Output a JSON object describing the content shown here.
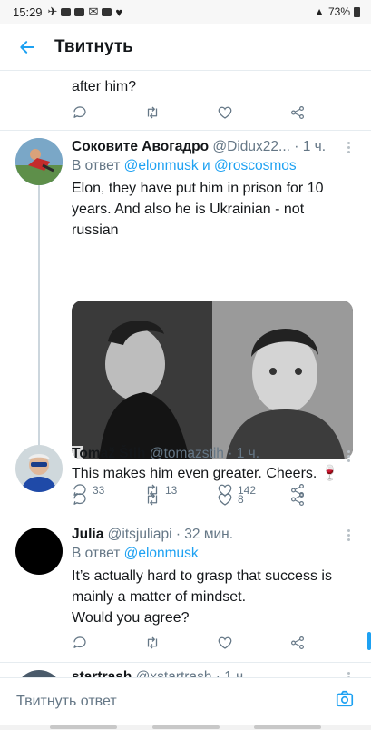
{
  "status_bar": {
    "time": "15:29",
    "battery": "73%"
  },
  "app_bar": {
    "title": "Твитнуть"
  },
  "tweet_prev": {
    "text_tail": "after him?"
  },
  "tweet1": {
    "name": "Соковите Авогадро",
    "handle": "@Didux22...",
    "time": "· 1 ч.",
    "reply_prefix": "В ответ",
    "reply_user1": "@elonmusk",
    "reply_and": "и",
    "reply_user2": "@roscosmos",
    "text": "Elon, they have put him in prison for 10 years. And also he is Ukrainian - not russian",
    "replies": "33",
    "retweets": "13",
    "likes": "142"
  },
  "tweet2": {
    "name": "Tomaž Štih",
    "handle": "@tomazstih",
    "time": "· 1 ч.",
    "text": "This makes him even greater. Cheers. 🍷",
    "likes": "8"
  },
  "tweet3": {
    "name": "Julia",
    "handle": "@itsjuliapi",
    "time": "· 32 мин.",
    "reply_prefix": "В ответ",
    "reply_user1": "@elonmusk",
    "text_line1": "It’s actually hard to grasp that success is",
    "text_line2": "mainly a matter of mindset.",
    "text_line3": "Would you agree?"
  },
  "tweet4": {
    "name": "startrash",
    "handle": "@xstartrash",
    "time": "· 1 ч."
  },
  "composer": {
    "placeholder": "Твитнуть ответ"
  },
  "colors": {
    "accent": "#1da1f2",
    "text": "#14171a",
    "muted": "#657786",
    "divider": "#e6ecf0"
  },
  "icons": {
    "reply": "reply-icon",
    "retweet": "retweet-icon",
    "like": "heart-icon",
    "share": "share-icon",
    "back": "back-arrow-icon",
    "camera": "camera-icon",
    "more": "more-vertical-icon"
  }
}
